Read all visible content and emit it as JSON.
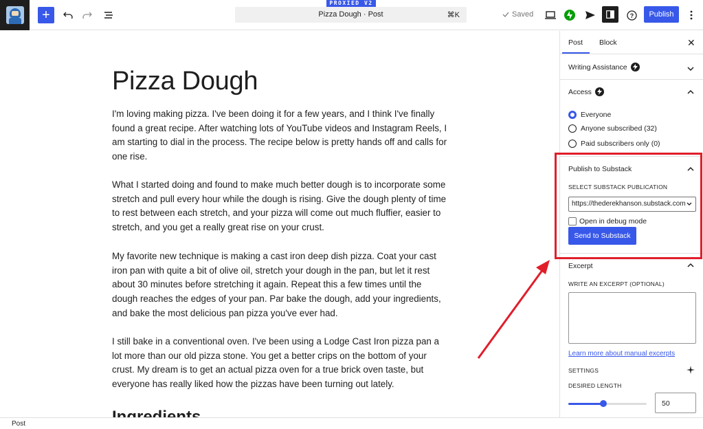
{
  "banner": "PROXIED V2",
  "toolbar": {
    "add_label": "+",
    "command_title": "Pizza Dough · Post",
    "command_shortcut": "⌘K",
    "saved_label": "Saved",
    "publish_label": "Publish"
  },
  "post": {
    "title": "Pizza Dough",
    "paragraphs": [
      "I'm loving making pizza. I've been doing it for a few years, and I think I've finally found a great recipe. After watching lots of YouTube videos and Instagram Reels, I am starting to dial in the process. The recipe below is pretty hands off and calls for one rise.",
      "What I started doing and found to make much better dough is to incorporate some stretch and pull every hour while the dough is rising. Give the dough plenty of time to rest between each stretch, and your pizza will come out much fluffier, easier to stretch, and you get a really great rise on your crust.",
      "My favorite new technique is making a cast iron deep dish pizza. Coat your cast iron pan with quite a bit of olive oil, stretch your dough in the pan, but let it rest about 30 minutes before stretching it again. Repeat this a few times until the dough reaches the edges of your pan. Par bake the dough, add your ingredients, and bake the most delicious pan pizza you've ever had.",
      "I still bake in a conventional oven. I've been using a Lodge Cast Iron pizza pan a lot more than our old pizza stone. You get a better crips on the bottom of your crust. My dream is to get an actual pizza oven for a true brick oven taste, but everyone has really liked how the pizzas have been turning out lately."
    ],
    "heading": "Ingredients"
  },
  "sidebar": {
    "tabs": [
      "Post",
      "Block"
    ],
    "writing_assistance": "Writing Assistance",
    "access": {
      "title": "Access",
      "options": [
        "Everyone",
        "Anyone subscribed (32)",
        "Paid subscribers only (0)"
      ],
      "selected": "Everyone"
    },
    "substack": {
      "title": "Publish to Substack",
      "select_label": "SELECT SUBSTACK PUBLICATION",
      "select_value": "https://thederekhanson.substack.com",
      "debug_label": "Open in debug mode",
      "send_label": "Send to Substack"
    },
    "excerpt": {
      "title": "Excerpt",
      "field_label": "WRITE AN EXCERPT (OPTIONAL)",
      "link": "Learn more about manual excerpts",
      "settings_label": "SETTINGS",
      "length_label": "DESIRED LENGTH",
      "length_value": "50",
      "length_fraction": 0.45
    }
  },
  "footer": {
    "breadcrumb": "Post"
  },
  "colors": {
    "accent": "#3858e9",
    "highlight": "#e11d2a"
  }
}
